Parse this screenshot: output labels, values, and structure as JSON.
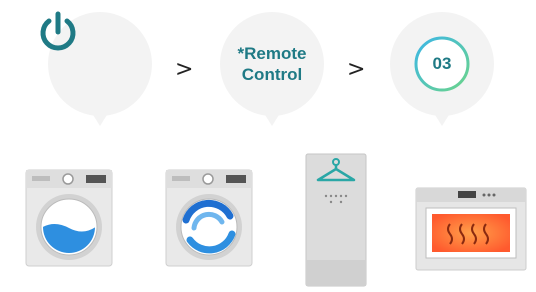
{
  "steps": [
    {
      "icon": "power-icon"
    },
    {
      "label": "*Remote\nControl"
    },
    {
      "code": "03"
    }
  ],
  "separators": [
    ">",
    ">"
  ],
  "appliances": [
    {
      "icon": "washer-icon"
    },
    {
      "icon": "washer-spin-icon"
    },
    {
      "icon": "clothes-styler-icon"
    },
    {
      "icon": "oven-icon"
    }
  ],
  "colors": {
    "accent": "#1f7a85",
    "ring_start": "#3cb6e6",
    "ring_end": "#6bd48a",
    "bubble": "#f4f4f4",
    "water": "#2e8fe0",
    "oven_glow": "#ff6a3a"
  }
}
